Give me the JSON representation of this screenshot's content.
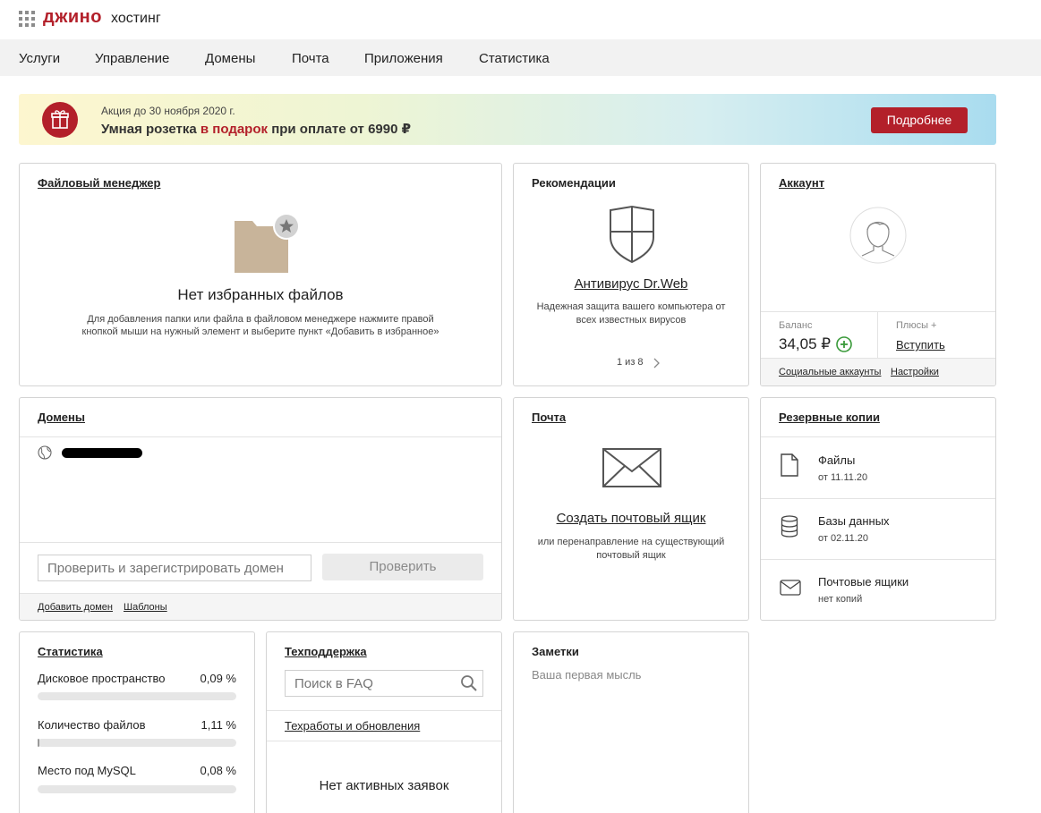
{
  "header": {
    "logo": "джино",
    "logo_sub": "хостинг"
  },
  "nav": {
    "items": [
      "Услуги",
      "Управление",
      "Домены",
      "Почта",
      "Приложения",
      "Статистика"
    ]
  },
  "promo": {
    "small": "Акция до 30 ноября 2020 г.",
    "big_part1": "Умная розетка ",
    "big_red": "в подарок",
    "big_part2": " при оплате от 6990 ₽",
    "button": "Подробнее"
  },
  "file_manager": {
    "title": "Файловый менеджер",
    "empty_title": "Нет избранных файлов",
    "hint_line1": "Для добавления папки или файла в файловом менеджере нажмите правой",
    "hint_line2": "кнопкой мыши на нужный элемент и выберите пункт «Добавить в избранное»"
  },
  "recommendations": {
    "title": "Рекомендации",
    "item_name": "Антивирус Dr.Web",
    "desc_line1": "Надежная защита вашего компьютера от",
    "desc_line2": "всех известных вирусов",
    "pager": "1 из 8"
  },
  "account": {
    "title": "Аккаунт",
    "balance_label": "Баланс",
    "balance_value": "34,05 ₽",
    "plus_label": "Плюсы +",
    "join_link": "Вступить",
    "social_link": "Социальные аккаунты",
    "settings_link": "Настройки"
  },
  "domains": {
    "title": "Домены",
    "input_placeholder": "Проверить и зарегистрировать домен",
    "check_button": "Проверить",
    "add_link": "Добавить домен",
    "templates_link": "Шаблоны"
  },
  "mail": {
    "title": "Почта",
    "create_link": "Создать почтовый ящик",
    "desc_line1": "или перенаправление на существующий",
    "desc_line2": "почтовый ящик"
  },
  "backups": {
    "title": "Резервные копии",
    "items": [
      {
        "name": "Файлы",
        "date": "от 11.11.20",
        "icon": "file-icon"
      },
      {
        "name": "Базы данных",
        "date": "от 02.11.20",
        "icon": "database-icon"
      },
      {
        "name": "Почтовые ящики",
        "date": "нет копий",
        "icon": "envelope-icon"
      }
    ]
  },
  "stats": {
    "title": "Статистика",
    "items": [
      {
        "label": "Дисковое пространство",
        "value": "0,09 %",
        "fraction": 0.0009
      },
      {
        "label": "Количество файлов",
        "value": "1,11 %",
        "fraction": 0.0111
      },
      {
        "label": "Место под MySQL",
        "value": "0,08 %",
        "fraction": 0.0008
      }
    ]
  },
  "support": {
    "title": "Техподдержка",
    "search_placeholder": "Поиск в FAQ",
    "works_link": "Техработы и обновления",
    "no_tickets": "Нет активных заявок"
  },
  "notes": {
    "title": "Заметки",
    "placeholder": "Ваша первая мысль"
  },
  "colors": {
    "brand": "#b3202a",
    "plus_green": "#3a9a3a"
  }
}
